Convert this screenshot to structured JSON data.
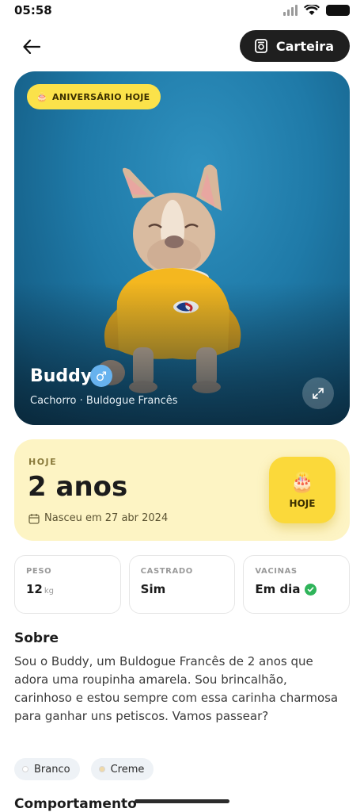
{
  "status_bar": {
    "time": "05:58"
  },
  "header": {
    "wallet_label": "Carteira"
  },
  "hero": {
    "birthday_tag": "ANIVERSÁRIO HOJE",
    "pet_name": "Buddy",
    "gender_symbol": "♂",
    "subtitle": "Cachorro · Buldogue Francês"
  },
  "age_card": {
    "label": "HOJE",
    "age": "2 anos",
    "born": "Nasceu em 27 abr 2024",
    "today_button": "HOJE"
  },
  "stats": [
    {
      "key": "PESO",
      "value": "12",
      "unit": "kg"
    },
    {
      "key": "CASTRADO",
      "value": "Sim"
    },
    {
      "key": "VACINAS",
      "value": "Em dia"
    }
  ],
  "about": {
    "title": "Sobre",
    "text": "Sou o Buddy, um Buldogue Francês de 2 anos que adora uma roupinha amarela. Sou brincalhão, carinhoso e estou sempre com essa carinha charmosa para ganhar uns petiscos. Vamos passear?"
  },
  "colors": {
    "chips": [
      {
        "label": "Branco",
        "color": "#ffffff"
      },
      {
        "label": "Creme",
        "color": "#f0d9a8"
      }
    ]
  },
  "behavior": {
    "title": "Comportamento"
  },
  "theme": {
    "accent": "#fbd93a",
    "wallet_bg": "#1f1f1f",
    "success": "#2fb45a",
    "gender": "#67b2ee"
  }
}
